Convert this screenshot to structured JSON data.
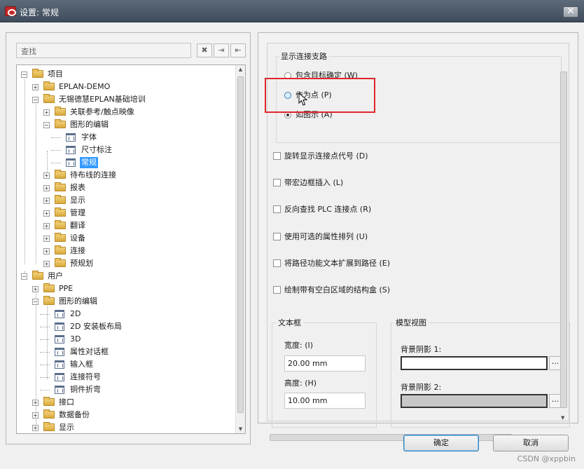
{
  "window": {
    "title": "设置: 常规",
    "close_symbol": "✕"
  },
  "left": {
    "search_placeholder": "查找",
    "tools": [
      {
        "name": "clear-search-button",
        "symbol": "✖"
      },
      {
        "name": "import-button",
        "symbol": "⇥"
      },
      {
        "name": "export-button",
        "symbol": "⇤"
      }
    ],
    "tree": [
      {
        "label": "项目",
        "level": 0,
        "icon": "folder",
        "exp": "−"
      },
      {
        "label": "EPLAN-DEMO",
        "level": 1,
        "icon": "folder",
        "exp": "+"
      },
      {
        "label": "无锡德慧EPLAN基础培训",
        "level": 1,
        "icon": "folder",
        "exp": "−"
      },
      {
        "label": "关联参考/触点映像",
        "level": 2,
        "icon": "folder",
        "exp": "+"
      },
      {
        "label": "图形的编辑",
        "level": 2,
        "icon": "folder",
        "exp": "−"
      },
      {
        "label": "字体",
        "level": 3,
        "icon": "page",
        "exp": ""
      },
      {
        "label": "尺寸标注",
        "level": 3,
        "icon": "page",
        "exp": ""
      },
      {
        "label": "常规",
        "level": 3,
        "icon": "page",
        "exp": "",
        "selected": true
      },
      {
        "label": "待布线的连接",
        "level": 2,
        "icon": "folder",
        "exp": "+"
      },
      {
        "label": "报表",
        "level": 2,
        "icon": "folder",
        "exp": "+"
      },
      {
        "label": "显示",
        "level": 2,
        "icon": "folder",
        "exp": "+"
      },
      {
        "label": "管理",
        "level": 2,
        "icon": "folder",
        "exp": "+"
      },
      {
        "label": "翻译",
        "level": 2,
        "icon": "folder",
        "exp": "+"
      },
      {
        "label": "设备",
        "level": 2,
        "icon": "folder",
        "exp": "+"
      },
      {
        "label": "连接",
        "level": 2,
        "icon": "folder",
        "exp": "+"
      },
      {
        "label": "预规划",
        "level": 2,
        "icon": "folder",
        "exp": "+"
      },
      {
        "label": "用户",
        "level": 0,
        "icon": "folder",
        "exp": "−"
      },
      {
        "label": "PPE",
        "level": 1,
        "icon": "folder",
        "exp": "+"
      },
      {
        "label": "图形的编辑",
        "level": 1,
        "icon": "folder",
        "exp": "−"
      },
      {
        "label": "2D",
        "level": 2,
        "icon": "page",
        "exp": ""
      },
      {
        "label": "2D 安装板布局",
        "level": 2,
        "icon": "page",
        "exp": ""
      },
      {
        "label": "3D",
        "level": 2,
        "icon": "page",
        "exp": ""
      },
      {
        "label": "属性对话框",
        "level": 2,
        "icon": "page",
        "exp": ""
      },
      {
        "label": "输入框",
        "level": 2,
        "icon": "page",
        "exp": ""
      },
      {
        "label": "连接符号",
        "level": 2,
        "icon": "page",
        "exp": ""
      },
      {
        "label": "铜件折弯",
        "level": 2,
        "icon": "page",
        "exp": ""
      },
      {
        "label": "接口",
        "level": 1,
        "icon": "folder",
        "exp": "+"
      },
      {
        "label": "数据备份",
        "level": 1,
        "icon": "folder",
        "exp": "+"
      },
      {
        "label": "显示",
        "level": 1,
        "icon": "folder",
        "exp": "+"
      }
    ]
  },
  "right": {
    "connection_group_title": "显示连接支路",
    "radios": [
      {
        "label": "包含目标确定 (W)",
        "checked": false
      },
      {
        "label": "作为点 (P)",
        "checked": false,
        "hover": true
      },
      {
        "label": "如图示 (A)",
        "checked": true
      }
    ],
    "checkboxes": [
      "旋转显示连接点代号 (D)",
      "带宏边框插入 (L)",
      "反向查找 PLC 连接点 (R)",
      "使用可选的属性排列 (U)",
      "将路径功能文本扩展到路径 (E)",
      "绘制带有空白区域的结构盒 (S)"
    ],
    "textframe": {
      "title": "文本框",
      "width_label": "宽度: (I)",
      "width_value": "20.00 mm",
      "height_label": "高度: (H)",
      "height_value": "10.00 mm"
    },
    "model_view": {
      "title": "模型视图",
      "bg1_label": "背景阴影 1:",
      "bg2_label": "背景阴影 2:",
      "dots": "..."
    }
  },
  "buttons": {
    "ok": "确定",
    "cancel": "取消"
  },
  "watermark": "CSDN @xppbin"
}
